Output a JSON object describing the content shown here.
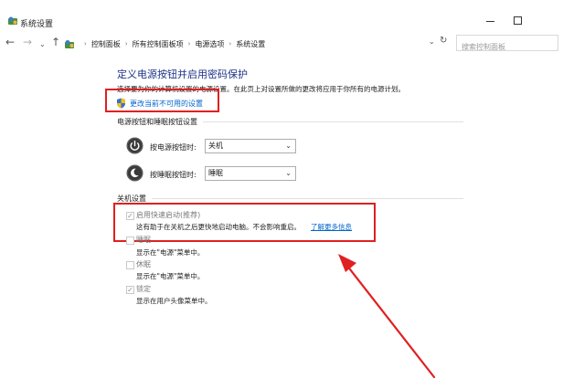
{
  "window": {
    "title": "系统设置"
  },
  "address_bar": {
    "breadcrumbs": [
      "控制面板",
      "所有控制面板项",
      "电源选项",
      "系统设置"
    ],
    "search_placeholder": "搜索控制面板"
  },
  "content": {
    "title": "定义电源按钮并启用密码保护",
    "description": "选择要为你的计算机设置的电源设置。在此页上对设置所做的更改将应用于你所有的电源计划。",
    "change_settings_link": "更改当前不可用的设置",
    "power_section": {
      "heading": "电源按钮和睡眠按钮设置",
      "power_button_label": "按电源按钮时:",
      "power_button_value": "关机",
      "sleep_button_label": "按睡眠按钮时:",
      "sleep_button_value": "睡眠"
    },
    "shutdown_section": {
      "heading": "关机设置",
      "fast_startup": {
        "label": "启用快速启动(推荐)",
        "description": "这有助于在关机之后更快地启动电脑。不会影响重启。",
        "learn_more": "了解更多信息",
        "checked": true
      },
      "sleep": {
        "label": "睡眠",
        "description": "显示在\"电源\"菜单中。",
        "checked": false
      },
      "hibernate": {
        "label": "休眠",
        "description": "显示在\"电源\"菜单中。",
        "checked": false
      },
      "lock": {
        "label": "锁定",
        "description": "显示在用户头像菜单中。",
        "checked": true
      }
    }
  },
  "colors": {
    "title_blue": "#1e3287",
    "link_blue": "#0066cc",
    "highlight_red": "#e02020"
  },
  "icons": [
    "shield-icon",
    "power-button-icon",
    "sleep-button-icon",
    "back-arrow-icon",
    "forward-arrow-icon",
    "up-arrow-icon",
    "refresh-icon",
    "control-panel-icon"
  ]
}
